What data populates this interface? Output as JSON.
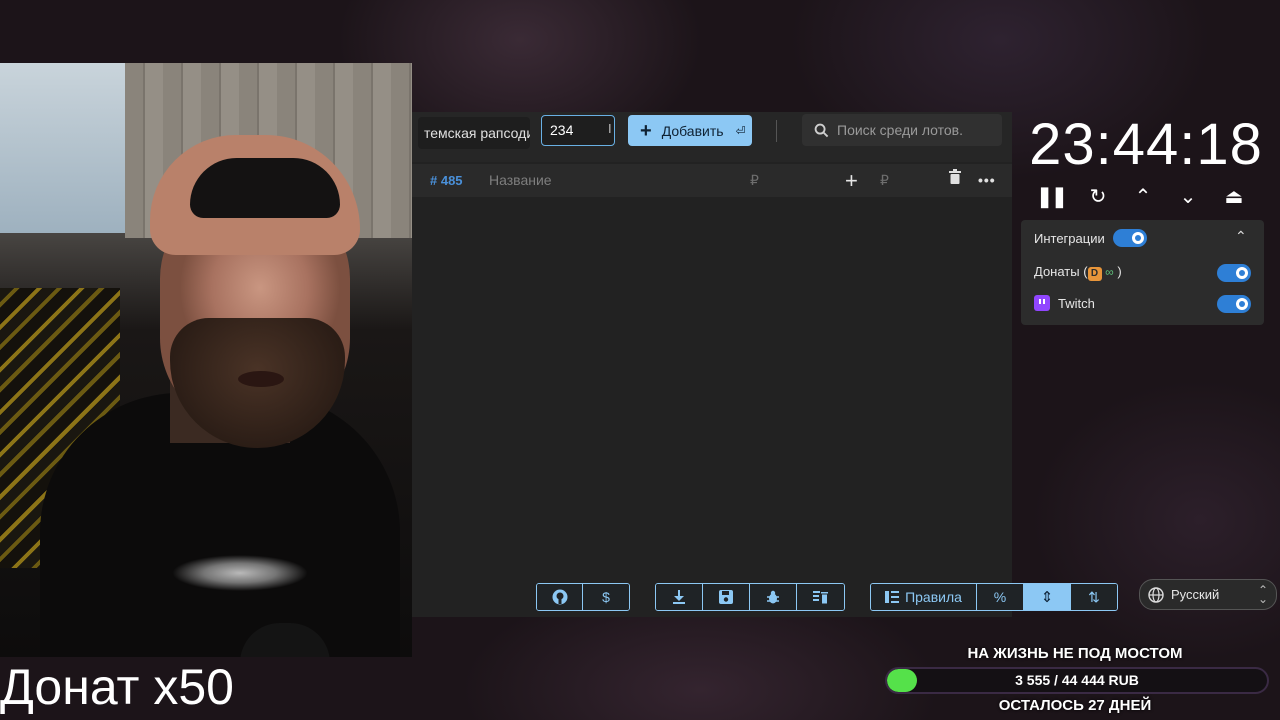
{
  "overlay": {
    "donate_multiplier": "Донат x50"
  },
  "toolbar": {
    "lot_name_value": "темская рапсодия",
    "amount_value": "234",
    "add_button_label": "Добавить",
    "add_button_icon": "enter-key-icon",
    "search_placeholder": "Поиск среди лотов."
  },
  "lot_row": {
    "number": "# 485",
    "title_placeholder": "Название",
    "currency_symbol": "₽",
    "add_amount_symbol": "+",
    "currency_symbol_2": "₽"
  },
  "footer": {
    "rules_label": "Правила",
    "percent_label": "%",
    "language": "Русский"
  },
  "timer": {
    "display": "23:44:18"
  },
  "integrations": {
    "title": "Интеграции",
    "enabled": true,
    "items": [
      {
        "label": "Донаты (",
        "label_suffix": " )",
        "enabled": true
      },
      {
        "label": "Twitch",
        "enabled": true
      }
    ]
  },
  "goal": {
    "title": "НА ЖИЗНЬ НЕ ПОД МОСТОМ",
    "amount_text": "3 555 / 44 444 RUB",
    "progress_fraction": 0.08,
    "remaining_text": "ОСТАЛОСЬ 27 ДНЕЙ",
    "fill_color": "#55e14a"
  },
  "colors": {
    "accent": "#8cc8f4",
    "toggle_on": "#2e7fd6",
    "lot_number": "#4a90d9",
    "twitch": "#9146ff"
  }
}
